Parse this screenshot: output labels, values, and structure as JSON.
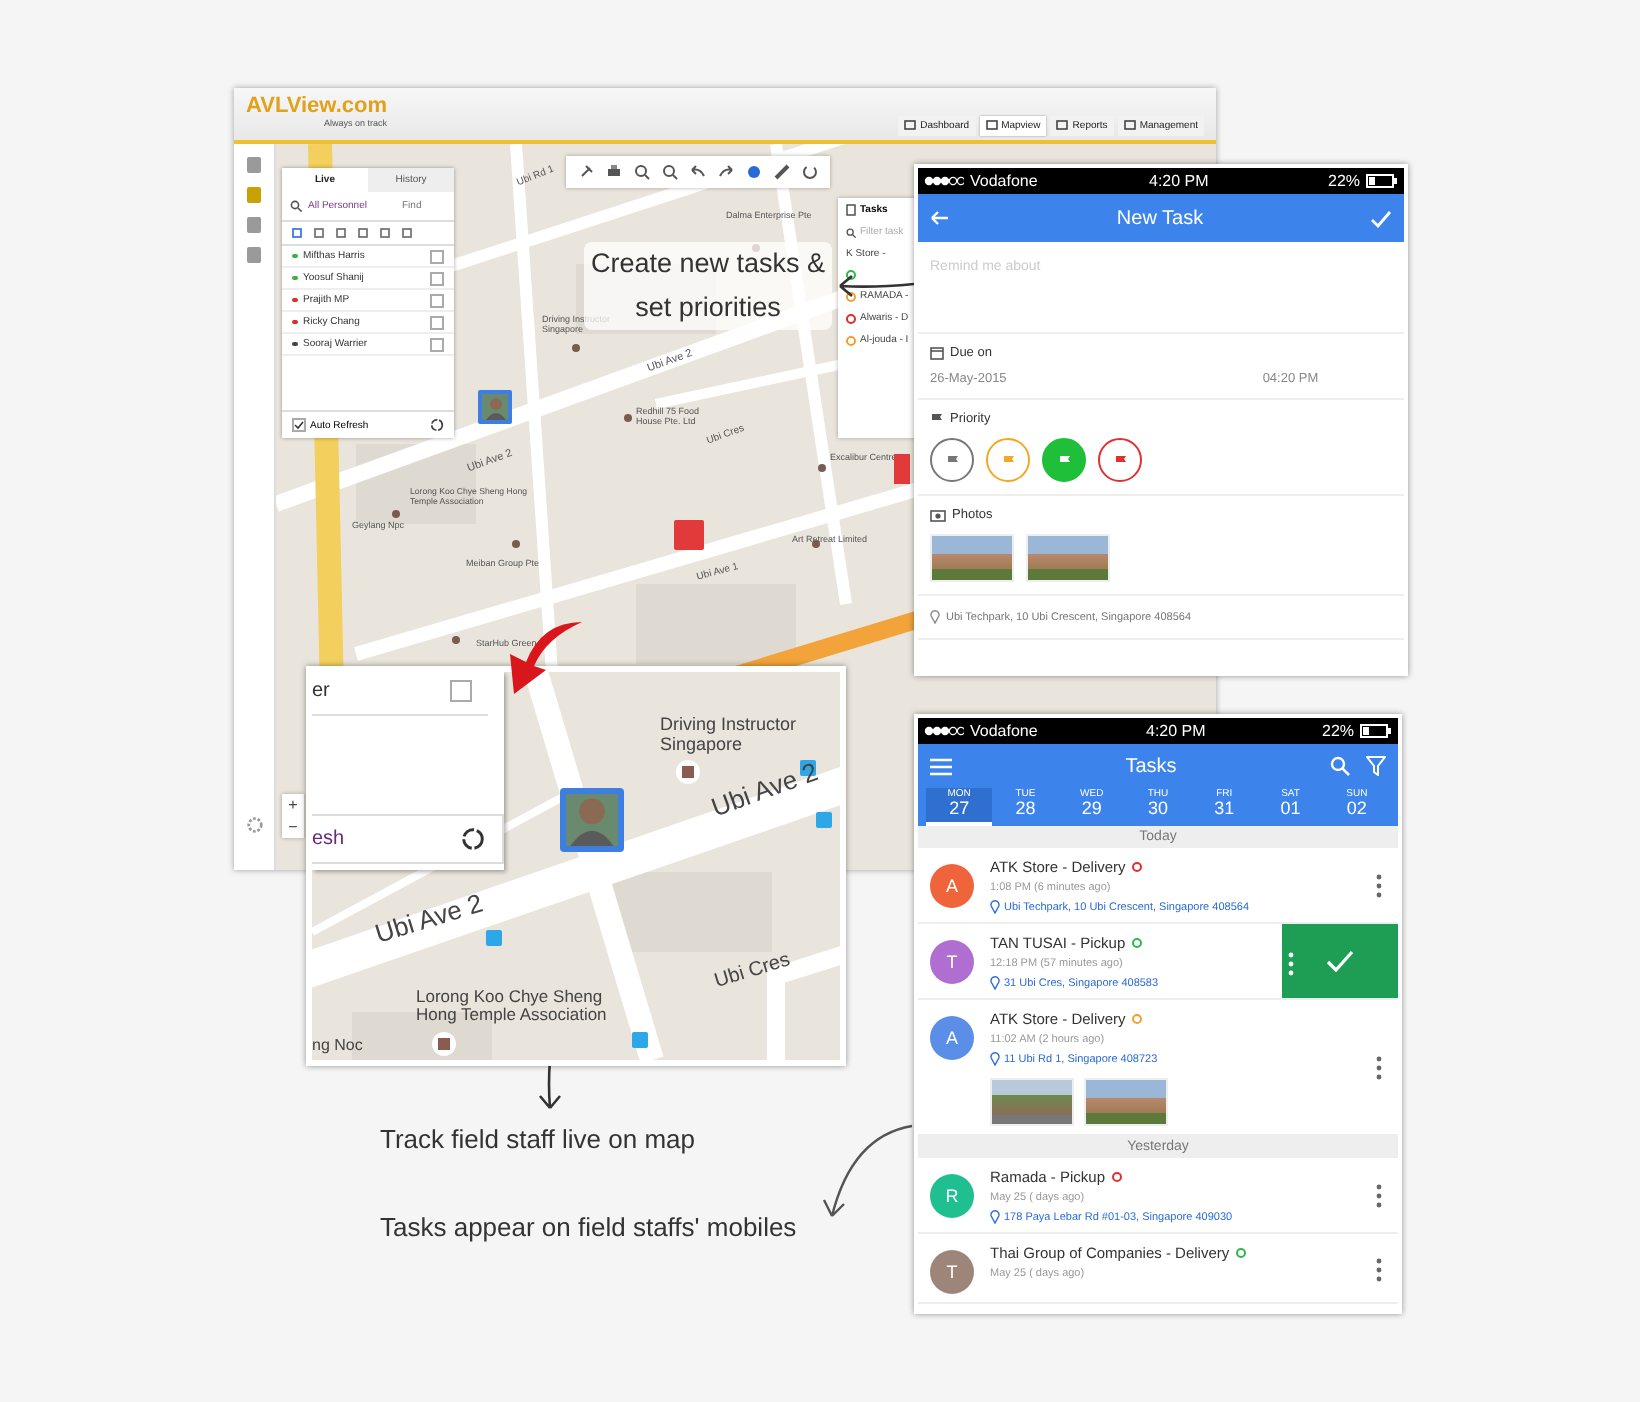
{
  "desktop": {
    "logo": "AVLView.com",
    "tagline": "Always on track",
    "nav": [
      {
        "label": "Dashboard",
        "selected": false
      },
      {
        "label": "Mapview",
        "selected": true
      },
      {
        "label": "Reports",
        "selected": false
      },
      {
        "label": "Management",
        "selected": false
      }
    ],
    "panel_tabs": [
      {
        "label": "Live",
        "selected": true
      },
      {
        "label": "History",
        "selected": false
      }
    ],
    "group_filter": "All Personnel",
    "find_placeholder": "Find",
    "personnel": [
      {
        "name": "Mifthas Harris",
        "color": "#3cb043",
        "checked": false
      },
      {
        "name": "Yoosuf Shanij",
        "color": "#3cb043",
        "checked": false
      },
      {
        "name": "Prajith MP",
        "color": "#d9302c",
        "checked": false
      },
      {
        "name": "Ricky Chang",
        "color": "#d9302c",
        "checked": false
      },
      {
        "name": "Sooraj Warrier",
        "color": "#444444",
        "checked": false
      }
    ],
    "auto_refresh": {
      "label": "Auto Refresh",
      "checked": true
    },
    "tasks_panel": {
      "title": "Tasks",
      "filter_placeholder": "Filter task",
      "items": [
        {
          "label": "K Store -"
        },
        {
          "color": "#2db84c"
        },
        {
          "label": "RAMADA -",
          "color": "#f0a030"
        },
        {
          "label": "Alwaris - D",
          "color": "#d9302c"
        },
        {
          "label": "Al-jouda - I",
          "color": "#f0a030"
        }
      ]
    },
    "map_labels": [
      "Ubi Rd 1",
      "Dalma Enterprise Pte",
      "Driving Instructor Singapore",
      "Redhill 75 Food House Pte. Ltd",
      "Ubi Ave 2",
      "Ubi Ave 2",
      "Ubi Cres",
      "Excalibur Centre",
      "Lorong Koo Chye Sheng Hong Temple Association",
      "Geylang Npc",
      "Meiban Group Pte",
      "Art Retreat Limited",
      "Ubi Ave 1",
      "StarHub Green"
    ],
    "zoom_controls": [
      "+",
      "−"
    ]
  },
  "callout": "Create new tasks & set priorities",
  "new_task_phone": {
    "carrier": "Vodafone",
    "time": "4:20 PM",
    "battery": "22%",
    "title": "New Task",
    "placeholder": "Remind me about",
    "due_label": "Due on",
    "due_date": "26-May-2015",
    "due_time": "04:20 PM",
    "priority_label": "Priority",
    "priorities": [
      {
        "color": "#777777",
        "selected": false
      },
      {
        "color": "#f5a623",
        "selected": false
      },
      {
        "color": "#1fbf3a",
        "selected": true
      },
      {
        "color": "#e03030",
        "selected": false
      }
    ],
    "photos_label": "Photos",
    "photos": [
      {
        "kind": "building"
      },
      {
        "kind": "building"
      }
    ],
    "location": "Ubi Techpark, 10 Ubi Crescent, Singapore 408564"
  },
  "inset": {
    "panel_text": "er",
    "checked": false,
    "refresh_text": "esh",
    "labels": [
      "Driving Instructor Singapore",
      "Ubi Ave 2",
      "Ubi Ave 2",
      "Ubi Cres",
      "Lorong Koo Chye Sheng Hong Temple Association",
      "ng Noc"
    ]
  },
  "captions": [
    "Track field staff live on map",
    "Tasks appear on field staffs' mobiles"
  ],
  "tasks_phone": {
    "carrier": "Vodafone",
    "time": "4:20 PM",
    "battery": "22%",
    "title": "Tasks",
    "days": [
      {
        "dow": "MON",
        "date": "27",
        "selected": true
      },
      {
        "dow": "TUE",
        "date": "28",
        "selected": false
      },
      {
        "dow": "WED",
        "date": "29",
        "selected": false
      },
      {
        "dow": "THU",
        "date": "30",
        "selected": false
      },
      {
        "dow": "FRI",
        "date": "31",
        "selected": false
      },
      {
        "dow": "SAT",
        "date": "01",
        "selected": false
      },
      {
        "dow": "SUN",
        "date": "02",
        "selected": false
      }
    ],
    "sections": [
      {
        "title": "Today",
        "tasks": [
          {
            "avatar": {
              "initial": "A",
              "color": "#f0643c"
            },
            "title": "ATK Store - Delivery",
            "status": {
              "color": "#e03030"
            },
            "time": "1:08 PM (6 minutes ago)",
            "address": "Ubi Techpark, 10 Ubi Crescent, Singapore 408564",
            "swiped": false
          },
          {
            "avatar": {
              "initial": "T",
              "color": "#b06fd0"
            },
            "title": "TAN TUSAI - Pickup",
            "status": {
              "color": "#2db84c"
            },
            "time": "12:18 PM (57 minutes ago)",
            "address": "31 Ubi Cres, Singapore 408583",
            "swiped": true
          },
          {
            "avatar": {
              "initial": "A",
              "color": "#5b8ee6"
            },
            "title": "ATK Store - Delivery",
            "status": {
              "color": "#f0a030"
            },
            "time": "11:02 AM (2 hours ago)",
            "address": "11 Ubi Rd 1, Singapore 408723",
            "swiped": false,
            "photos": [
              {
                "kind": "street"
              },
              {
                "kind": "building"
              }
            ]
          }
        ]
      },
      {
        "title": "Yesterday",
        "tasks": [
          {
            "avatar": {
              "initial": "R",
              "color": "#1fbf8f"
            },
            "title": "Ramada - Pickup",
            "status": {
              "color": "#e03030"
            },
            "time": "May 25 ( days ago)",
            "address": "178 Paya Lebar Rd #01-03, Singapore 409030",
            "swiped": false
          },
          {
            "avatar": {
              "initial": "T",
              "color": "#9e8579"
            },
            "title": "Thai Group of Companies - Delivery",
            "status": {
              "color": "#2db84c"
            },
            "time": "May 25 ( days ago)",
            "swiped": false
          }
        ]
      }
    ]
  }
}
